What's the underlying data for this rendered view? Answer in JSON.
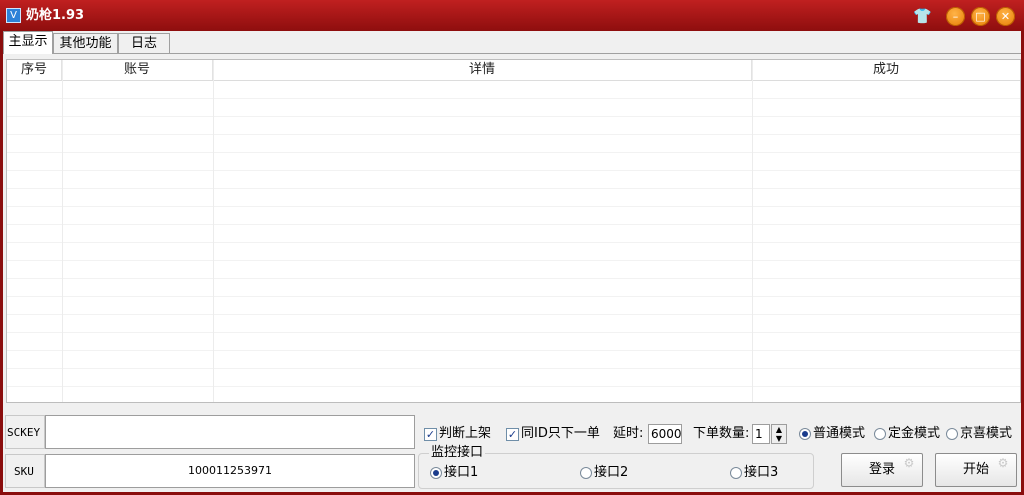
{
  "window": {
    "title": "奶枪1.93",
    "app_icon_text": "V"
  },
  "titlebar_buttons": {
    "skin": "👕",
    "minimize": "–",
    "maximize": "□",
    "close": "✕"
  },
  "tabs": [
    {
      "label": "主显示",
      "active": true
    },
    {
      "label": "其他功能",
      "active": false
    },
    {
      "label": "日志",
      "active": false
    }
  ],
  "grid": {
    "columns": [
      "序号",
      "账号",
      "详情",
      "成功"
    ]
  },
  "sckey": {
    "label": "SCKEY",
    "value": ""
  },
  "sku": {
    "label": "SKU",
    "value": "100011253971"
  },
  "options": {
    "check_shelf_label": "判断上架",
    "check_shelf": "✓",
    "same_id_label": "同ID只下一单",
    "same_id": "✓",
    "delay_label": "延时:",
    "delay_value": "6000",
    "order_qty_label": "下单数量:",
    "order_qty_value": "1",
    "spin_up": "▲",
    "spin_down": "▼"
  },
  "modes": [
    {
      "label": "普通模式",
      "selected": true
    },
    {
      "label": "定金模式",
      "selected": false
    },
    {
      "label": "京喜模式",
      "selected": false
    }
  ],
  "monitor": {
    "title": "监控接口",
    "interfaces": [
      {
        "label": "接口1",
        "selected": true
      },
      {
        "label": "接口2",
        "selected": false
      },
      {
        "label": "接口3",
        "selected": false
      }
    ]
  },
  "buttons": {
    "login": "登录",
    "start": "开始",
    "deco": "⚙"
  }
}
